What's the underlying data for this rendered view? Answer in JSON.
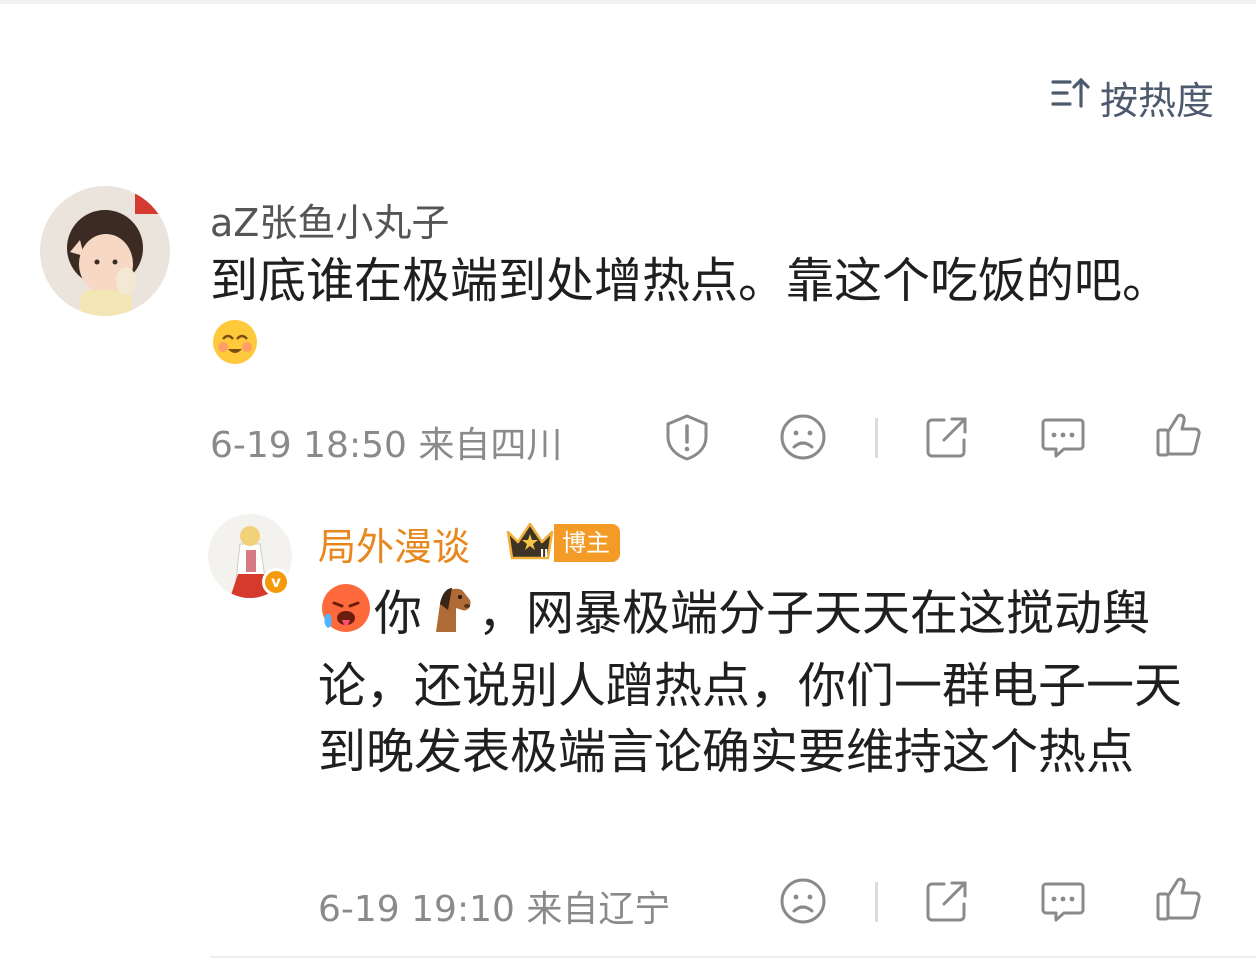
{
  "sort": {
    "label": "按热度",
    "icon": "sort-icon"
  },
  "comments": [
    {
      "username": "aZ张鱼小丸子",
      "text": "到底谁在极端到处增热点。靠这个吃饭的吧。",
      "emoji": "smiling-blush-emoji",
      "time": "6-19 18:50",
      "location": "来自四川",
      "actions": [
        "report-icon",
        "dislike-icon",
        "share-icon",
        "comment-icon",
        "like-icon"
      ]
    }
  ],
  "replies": [
    {
      "username": "局外漫谈",
      "badge_label": "博主",
      "badge_level": "II",
      "text_after_emojis": "，网暴极端分子天天在这搅动舆论，还说别人蹭热点，你们一群电子一天到晚发表极端言论确实要维持这个热点",
      "inline_word": "你",
      "emojis": [
        "hot-face-emoji",
        "horse-emoji"
      ],
      "time": "6-19 19:10",
      "location": "来自辽宁",
      "actions": [
        "dislike-icon",
        "share-icon",
        "comment-icon",
        "like-icon"
      ],
      "verified": "v"
    }
  ],
  "colors": {
    "author_name": "#e8871e",
    "meta": "#8a8a8a",
    "sort": "#4d5a6e",
    "badge": "#f39a27"
  }
}
